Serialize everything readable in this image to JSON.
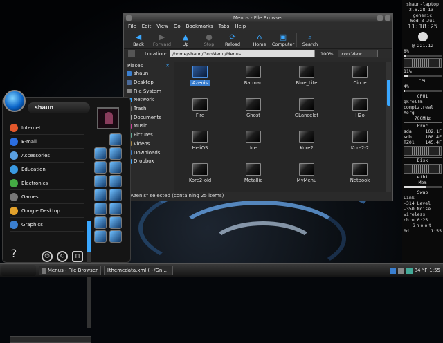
{
  "window": {
    "title": "Menus - File Browser",
    "menu": [
      "File",
      "Edit",
      "View",
      "Go",
      "Bookmarks",
      "Tabs",
      "Help"
    ],
    "toolbar": [
      {
        "label": "Back",
        "icon": "arrow-left-icon"
      },
      {
        "label": "Forward",
        "icon": "arrow-right-icon"
      },
      {
        "label": "Up",
        "icon": "arrow-up-icon"
      },
      {
        "label": "Stop",
        "icon": "stop-icon"
      },
      {
        "label": "Reload",
        "icon": "reload-icon"
      },
      {
        "label": "Home",
        "icon": "home-icon"
      },
      {
        "label": "Computer",
        "icon": "computer-icon"
      },
      {
        "label": "Search",
        "icon": "search-icon"
      }
    ],
    "location_label": "Location:",
    "location_value": "/home/shaun/GnoMenu/Menus",
    "zoom": "100%",
    "view": "Icon View",
    "places_header": "Places",
    "places": [
      "shaun",
      "Desktop",
      "File System",
      "Network",
      "Trash",
      "Documents",
      "Music",
      "Pictures",
      "Videos",
      "Downloads",
      "Dropbox"
    ],
    "files": [
      "Azenis",
      "Batman",
      "Blue_Lite",
      "Circle",
      "Fire",
      "Ghost",
      "GLancelot",
      "H2o",
      "HeliOS",
      "Ice",
      "Kore2",
      "Kore2-2",
      "Kore2-old",
      "Metallic",
      "MyMenu",
      "Netbook"
    ],
    "status": "\"Azenis\" selected (containing 25 items)"
  },
  "menu": {
    "user": "shaun",
    "categories": [
      "Internet",
      "E-mail",
      "Accessories",
      "Education",
      "Electronics",
      "Games",
      "Google Desktop",
      "Graphics"
    ]
  },
  "taskbar": {
    "tasks": [
      "Menus - File Browser",
      "[themedata.xml (~/Gn..."
    ],
    "temp": "84 °F",
    "time": "1:55"
  },
  "sysmon": {
    "host": "shaun-laptop",
    "kernel": "2.6.28-13-generic",
    "date": "Wed  8 Jul",
    "time": "11:18:25",
    "moon": "@ 221.12",
    "cpu_vals": [
      "8%",
      "11%",
      "4%"
    ],
    "cpu_label": "CPU",
    "cpu1": "CPU1",
    "cpu_fill": [
      0.08,
      0.11,
      0.04
    ],
    "procs": [
      "gkrellm",
      "compiz.real",
      "Xorg"
    ],
    "mhz": "700MHz",
    "proc_head": "Proc",
    "proc_rows": [
      [
        "sda",
        "102.1F"
      ],
      [
        "sdb",
        "100.4F"
      ],
      [
        "TZ01",
        "145.4F"
      ]
    ],
    "disk": "Disk",
    "eth": "eth1",
    "mem": "Mem",
    "swap": "Swap",
    "link": "Link",
    "level": "-314 Level",
    "noise": "-350 Noise",
    "wireless": "wireless",
    "chru": "chru  0:25",
    "shoot": "Shoot",
    "od": "0d",
    "clock": "1:55"
  }
}
